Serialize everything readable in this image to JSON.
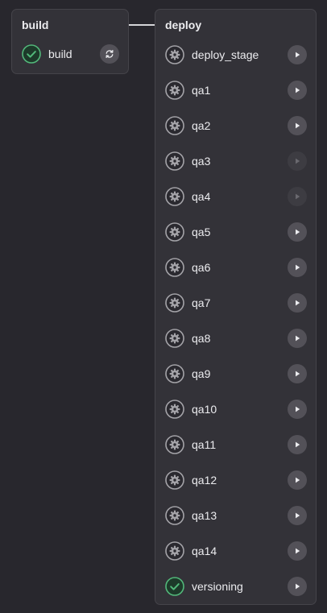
{
  "stages": {
    "build": {
      "title": "build",
      "jobs": [
        {
          "name": "build",
          "status": "success",
          "status_icon": "check-circle-icon",
          "action": "retry",
          "action_icon": "retry-icon",
          "action_enabled": true
        }
      ]
    },
    "deploy": {
      "title": "deploy",
      "jobs": [
        {
          "name": "deploy_stage",
          "status": "manual",
          "status_icon": "gear-icon",
          "action": "play",
          "action_icon": "play-icon",
          "action_enabled": true
        },
        {
          "name": "qa1",
          "status": "manual",
          "status_icon": "gear-icon",
          "action": "play",
          "action_icon": "play-icon",
          "action_enabled": true
        },
        {
          "name": "qa2",
          "status": "manual",
          "status_icon": "gear-icon",
          "action": "play",
          "action_icon": "play-icon",
          "action_enabled": true
        },
        {
          "name": "qa3",
          "status": "manual",
          "status_icon": "gear-icon",
          "action": "play",
          "action_icon": "play-icon",
          "action_enabled": false
        },
        {
          "name": "qa4",
          "status": "manual",
          "status_icon": "gear-icon",
          "action": "play",
          "action_icon": "play-icon",
          "action_enabled": false
        },
        {
          "name": "qa5",
          "status": "manual",
          "status_icon": "gear-icon",
          "action": "play",
          "action_icon": "play-icon",
          "action_enabled": true
        },
        {
          "name": "qa6",
          "status": "manual",
          "status_icon": "gear-icon",
          "action": "play",
          "action_icon": "play-icon",
          "action_enabled": true
        },
        {
          "name": "qa7",
          "status": "manual",
          "status_icon": "gear-icon",
          "action": "play",
          "action_icon": "play-icon",
          "action_enabled": true
        },
        {
          "name": "qa8",
          "status": "manual",
          "status_icon": "gear-icon",
          "action": "play",
          "action_icon": "play-icon",
          "action_enabled": true
        },
        {
          "name": "qa9",
          "status": "manual",
          "status_icon": "gear-icon",
          "action": "play",
          "action_icon": "play-icon",
          "action_enabled": true
        },
        {
          "name": "qa10",
          "status": "manual",
          "status_icon": "gear-icon",
          "action": "play",
          "action_icon": "play-icon",
          "action_enabled": true
        },
        {
          "name": "qa11",
          "status": "manual",
          "status_icon": "gear-icon",
          "action": "play",
          "action_icon": "play-icon",
          "action_enabled": true
        },
        {
          "name": "qa12",
          "status": "manual",
          "status_icon": "gear-icon",
          "action": "play",
          "action_icon": "play-icon",
          "action_enabled": true
        },
        {
          "name": "qa13",
          "status": "manual",
          "status_icon": "gear-icon",
          "action": "play",
          "action_icon": "play-icon",
          "action_enabled": true
        },
        {
          "name": "qa14",
          "status": "manual",
          "status_icon": "gear-icon",
          "action": "play",
          "action_icon": "play-icon",
          "action_enabled": true
        },
        {
          "name": "versioning",
          "status": "success",
          "status_icon": "check-circle-icon",
          "action": "play",
          "action_icon": "play-icon",
          "action_enabled": true
        }
      ]
    }
  },
  "colors": {
    "background": "#28272d",
    "card": "#333238",
    "success": "#52b87a",
    "manual": "#a4a3a8",
    "action_button": "#535158",
    "action_button_disabled": "#3d3c42"
  }
}
